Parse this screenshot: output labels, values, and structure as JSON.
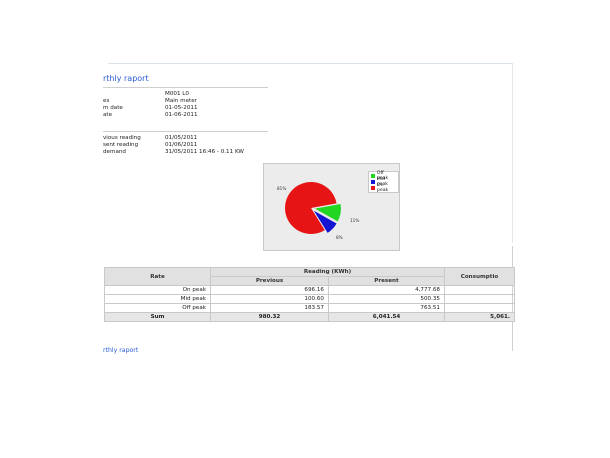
{
  "report": {
    "title": "rthly raport",
    "footer_link": "rthly raport"
  },
  "info_rows": [
    {
      "label": "",
      "value": "M001 L0"
    },
    {
      "label": "es",
      "value": "Main meter"
    },
    {
      "label": "m date",
      "value": "01-05-2011"
    },
    {
      "label": "ate",
      "value": "01-06-2011"
    }
  ],
  "reading_rows": [
    {
      "label": "vious reading",
      "value": "01/05/2011"
    },
    {
      "label": "sent reading",
      "value": "01/06/2011"
    },
    {
      "label": "demand",
      "value": "31/05/2011 16:46 - 0.11 KW"
    }
  ],
  "chart_data": {
    "type": "pie",
    "labels": [
      "Off peak",
      "Mid peak",
      "On peak"
    ],
    "values": [
      11,
      8,
      81
    ],
    "colors": [
      "#22d522",
      "#1414d2",
      "#e61414"
    ],
    "slice_labels": [
      "11%",
      "8%",
      "81%"
    ],
    "legend_position": "top-right"
  },
  "table": {
    "col_rate": "Rate",
    "col_reading": "Reading (KWh)",
    "col_previous": "Previous",
    "col_present": "Present",
    "col_consumption": "Consumptio",
    "rows": [
      {
        "rate": "On peak",
        "previous": "696.16",
        "present": "4,777.68",
        "consumption": ""
      },
      {
        "rate": "Mid peak",
        "previous": "100.60",
        "present": "500.35",
        "consumption": ""
      },
      {
        "rate": "Off peak",
        "previous": "183.57",
        "present": "763.51",
        "consumption": ""
      }
    ],
    "sum": {
      "rate": "Sum",
      "previous": "980.32",
      "present": "6,041.54",
      "consumption": "5,061."
    }
  }
}
